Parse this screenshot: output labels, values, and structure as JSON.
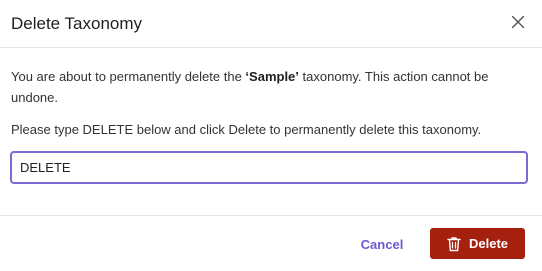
{
  "dialog": {
    "title": "Delete Taxonomy",
    "message_prefix": "You are about to permanently delete the ",
    "quote_open": "‘",
    "taxonomy_name": "Sample",
    "quote_close": "’",
    "message_suffix": " taxonomy. This action cannot be undone.",
    "instruction": "Please type DELETE below and click Delete to permanently delete this taxonomy.",
    "confirm_input_value": "DELETE",
    "cancel_label": "Cancel",
    "delete_label": "Delete",
    "icons": {
      "close": "close-icon",
      "delete": "trash-icon"
    },
    "colors": {
      "accent": "#6b5bd2",
      "input_border": "#7c6bd6",
      "danger": "#a5200f"
    }
  }
}
